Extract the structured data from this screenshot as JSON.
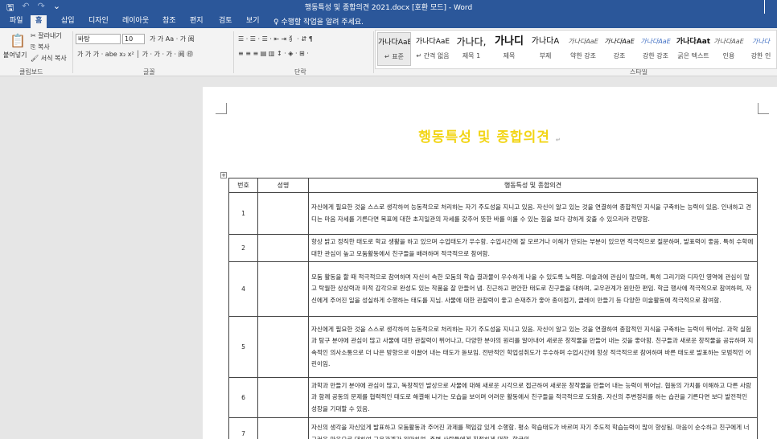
{
  "titlebar": {
    "quick_access": [
      "🖫",
      "↶",
      "↷",
      "⌄"
    ],
    "title": "행동특성 및 종합의견 2021.docx [호환 모드] - Word"
  },
  "tabs": [
    "파일",
    "홈",
    "삽입",
    "디자인",
    "레이아웃",
    "참조",
    "편지",
    "검토",
    "보기"
  ],
  "active_tab": "홈",
  "tell_me": "수행할 작업을 알려 주세요.",
  "clipboard": {
    "paste": "붙여넣기",
    "cut": "잘라내기",
    "copy": "복사",
    "format_painter": "서식 복사",
    "label": "클립보드"
  },
  "font": {
    "name": "바탕",
    "size": "10",
    "label": "글꼴"
  },
  "paragraph": {
    "label": "단락"
  },
  "styles": {
    "label": "스타일",
    "items": [
      {
        "preview": "가나다AaE",
        "label": "↵ 표준"
      },
      {
        "preview": "가나다AaE",
        "label": "↵ 간격 없음"
      },
      {
        "preview": "가나다,",
        "label": "제목 1"
      },
      {
        "preview": "가나디",
        "label": "제목"
      },
      {
        "preview": "가나다A",
        "label": "부제"
      },
      {
        "preview": "가나다AaE",
        "label": "약한 강조"
      },
      {
        "preview": "가나다AaE",
        "label": "강조"
      },
      {
        "preview": "가나다AaE",
        "label": "강한 강조"
      },
      {
        "preview": "가나다Aat",
        "label": "굵은 텍스트"
      },
      {
        "preview": "가나다AaE",
        "label": "인용"
      },
      {
        "preview": "가나다",
        "label": "강한 인"
      }
    ]
  },
  "document": {
    "heading": "행동특성 및 종합의견",
    "table": {
      "headers": [
        "번호",
        "성명",
        "행동특성 및 종합의견"
      ],
      "rows": [
        {
          "num": "1",
          "name": "",
          "text": "자신에게 필요한 것을 스스로 생각하여 능동적으로 처리하는 자기 주도성을 지니고 있음. 자신이 알고 있는 것을 연결하여 종합적인 지식을 구축하는 능력이 있음. 인내하고 견디는 마음 자세를 기른다면 목표에 대한 초지일관의 자세를 갖추어 뜻한 바를 이룰 수 있는 힘을 보다 강하게 갖출 수 있으리라 전망함."
        },
        {
          "num": "2",
          "name": "",
          "text": "항상 밝고 정직한 태도로 학교 생활을 하고 있으며 수업태도가 우수함. 수업시간에 잘 모르거나 이해가 안되는 부분이 있으면 적극적으로 질문하며, 발표력이 좋음. 특히 수학에 대한 관심이 높고 모둠활동에서 친구들을 배려하며 적극적으로 참여함."
        },
        {
          "num": "4",
          "name": "",
          "text": "모둠 활동을 할 때 적극적으로 참여하며 자신이 속한 모둠의 학습 결과물이 우수하게 나올 수 있도록 노력함. 미술과에 관심이 많으며, 특히 그리기와 디자인 영역에 관심이 많고 탁월한 상상력과 미적 감각으로 완성도 있는 작품을 잘 만들어 냄. 친근하고 편안한 태도로 친구들을 대하며, 교우관계가 원만한 편임. 학급 행사에 적극적으로 참여하며, 자신에게 주어진 일을 성실하게 수행하는 태도를 지님. 사물에 대한 관찰력이 좋고 손재주가 좋아 종이접기, 클레이 만들기 등 다양한 미술활동에 적극적으로 참여함."
        },
        {
          "num": "5",
          "name": "",
          "text": "자신에게 필요한 것을 스스로 생각하여 능동적으로 처리하는 자기 주도성을 지니고 있음. 자신이 알고 있는 것을 연결하여 종합적인 지식을 구축하는 능력이 뛰어남. 과학 실험과 탐구 분야에 관심이 많고 사물에 대한 관찰력이 뛰어나고, 다양한 분야의 원리를 알아내어 새로운 창작물을 만들어 내는 것을 좋아함. 친구들과 새로운 창작물을 공유하며 지속적인 의사소통으로 더 나은 방향으로 이끌어 내는 태도가 돋보임. 전반적인 학업성취도가 우수하며 수업시간에 항상 적극적으로 참여하며 바른 태도로 발표하는 모범적인 어린이임."
        },
        {
          "num": "6",
          "name": "",
          "text": "과학과 만들기 분야에 관심이 많고, 독창적인 발상으로 사물에 대해 새로운 시각으로 접근하여 새로운 창작물을 만들어 내는 능력이 뛰어남. 협동의 가치를 이해하고 다른 사람과 함께 공동의 문제를 협력적인 태도로 해결해 나가는 모습을 보이며 어려운 활동에서 친구들을 적극적으로 도와줌. 자신의 주변정리를 하는 습관을 기른다면 보다 발전적인 성장을 기대할 수 있음."
        },
        {
          "num": "7",
          "name": "",
          "text": "자신의 생각을 자신있게 발표하고 모둠활동과 주어진 과제를 책임감 있게 수행함. 평소 학습태도가 바르며 자기 주도적 학습능력이 많이 향상됨. 마음이 순수하고 친구에게 너그러운 마음으로 대하여 교우관계가 원만하며, 주변 사람들에게 친절하게 대함. 학급의"
        }
      ]
    }
  }
}
